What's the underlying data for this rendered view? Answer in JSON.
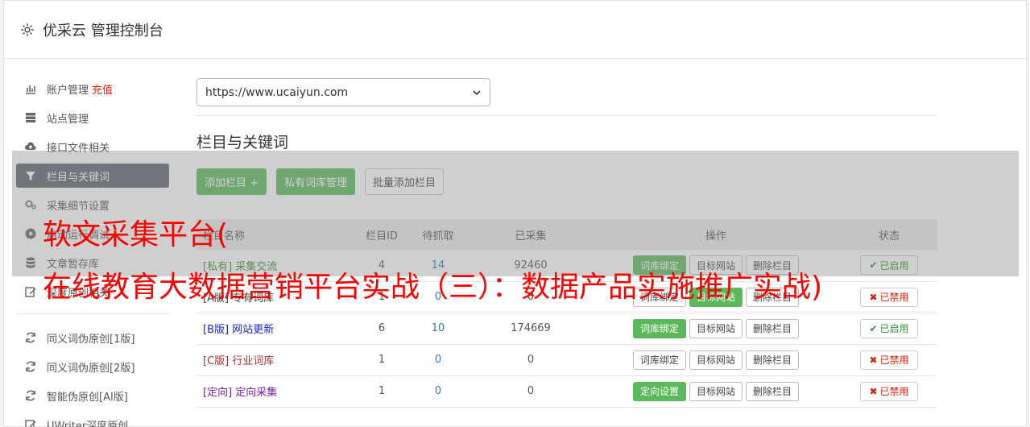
{
  "header": {
    "title": "优采云 管理控制台"
  },
  "sidebar": {
    "items": [
      {
        "label": "账户管理",
        "extra": "充值",
        "icon": "bar-chart-icon"
      },
      {
        "label": "站点管理",
        "icon": "server-icon"
      },
      {
        "label": "接口文件相关",
        "icon": "cloud-upload-icon"
      },
      {
        "label": "栏目与关键词",
        "icon": "filter-icon",
        "active": true
      },
      {
        "label": "采集细节设置",
        "icon": "cogs-icon"
      },
      {
        "label": "启动运行调试",
        "icon": "play-circle-icon"
      },
      {
        "label": "文章暂存库",
        "icon": "database-icon"
      },
      {
        "label": "深度原创相关",
        "icon": "edit-icon"
      }
    ],
    "tools": [
      {
        "label": "同义词伪原创[1版]",
        "icon": "refresh-icon"
      },
      {
        "label": "同义词伪原创[2版]",
        "icon": "refresh-icon"
      },
      {
        "label": "智能伪原创[AI版]",
        "icon": "refresh-icon"
      },
      {
        "label": "UWriter深度原创",
        "icon": "edit-icon"
      }
    ]
  },
  "main": {
    "site_select": "https://www.ucaiyun.com",
    "section_title": "栏目与关键词",
    "buttons": {
      "add": "添加栏目 +",
      "private_lib": "私有词库管理",
      "batch_add": "批量添加栏目"
    },
    "table": {
      "headers": [
        "栏目名称",
        "栏目ID",
        "待抓取",
        "已采集",
        "操作",
        "状态"
      ],
      "rows": [
        {
          "tag": "[私有]",
          "name": "采集交流",
          "id": "4",
          "pending": "14",
          "collected": "92460",
          "op1": "词库绑定",
          "op1_green": true,
          "op2": "目标网站",
          "op3": "删除栏目",
          "status": "已启用",
          "status_on": true,
          "color": "#3c8b3c"
        },
        {
          "tag": "[A版]",
          "name": "专有词库",
          "id": "1",
          "pending": "0",
          "collected": "0",
          "op1": "词库绑定",
          "op1_green": false,
          "op2": "目标网站",
          "op2_green": true,
          "op3": "删除栏目",
          "status": "已禁用",
          "status_on": false,
          "color": "#444444"
        },
        {
          "tag": "[B版]",
          "name": "网站更新",
          "id": "6",
          "pending": "10",
          "collected": "174669",
          "op1": "词库绑定",
          "op1_green": true,
          "op2": "目标网站",
          "op3": "删除栏目",
          "status": "已启用",
          "status_on": true,
          "color": "#1a25c7"
        },
        {
          "tag": "[C版]",
          "name": "行业词库",
          "id": "1",
          "pending": "0",
          "collected": "0",
          "op1": "词库绑定",
          "op1_green": false,
          "op2": "目标网站",
          "op3": "删除栏目",
          "status": "已禁用",
          "status_on": false,
          "color": "#a83232"
        },
        {
          "tag": "[定向]",
          "name": "定向采集",
          "id": "1",
          "pending": "0",
          "collected": "0",
          "op1": "定向设置",
          "op1_green": true,
          "op2": "目标网站",
          "op3": "删除栏目",
          "status": "已禁用",
          "status_on": false,
          "color": "#7a1fa8"
        }
      ]
    }
  },
  "watermark": {
    "line1": "软文采集平台(",
    "line2": "在线教育大数据营销平台实战（三）：数据产品实施推广实战)"
  }
}
